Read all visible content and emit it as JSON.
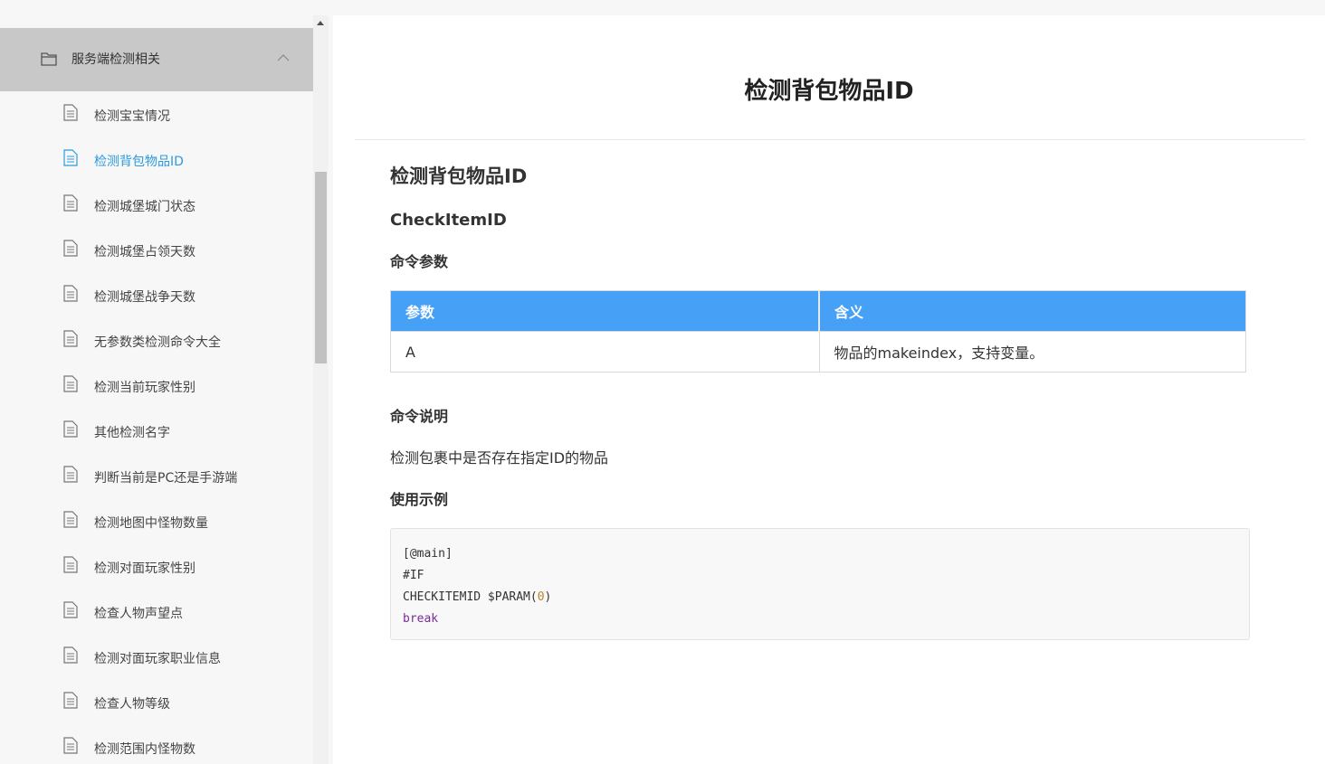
{
  "sidebar": {
    "group": {
      "title": "服务端检测相关",
      "icon": "folder-icon",
      "expanded_icon": "chevron-up-icon"
    },
    "items": [
      {
        "label": "检测宝宝情况",
        "icon": "document-icon",
        "active": false
      },
      {
        "label": "检测背包物品ID",
        "icon": "document-icon",
        "active": true
      },
      {
        "label": "检测城堡城门状态",
        "icon": "document-icon",
        "active": false
      },
      {
        "label": "检测城堡占领天数",
        "icon": "document-icon",
        "active": false
      },
      {
        "label": "检测城堡战争天数",
        "icon": "document-icon",
        "active": false
      },
      {
        "label": "无参数类检测命令大全",
        "icon": "document-icon",
        "active": false
      },
      {
        "label": "检测当前玩家性别",
        "icon": "document-icon",
        "active": false
      },
      {
        "label": "其他检测名字",
        "icon": "document-icon",
        "active": false
      },
      {
        "label": "判断当前是PC还是手游端",
        "icon": "document-icon",
        "active": false
      },
      {
        "label": "检测地图中怪物数量",
        "icon": "document-icon",
        "active": false
      },
      {
        "label": "检测对面玩家性别",
        "icon": "document-icon",
        "active": false
      },
      {
        "label": "检查人物声望点",
        "icon": "document-icon",
        "active": false
      },
      {
        "label": "检测对面玩家职业信息",
        "icon": "document-icon",
        "active": false
      },
      {
        "label": "检查人物等级",
        "icon": "document-icon",
        "active": false
      },
      {
        "label": "检测范围内怪物数",
        "icon": "document-icon",
        "active": false
      }
    ]
  },
  "main": {
    "page_title": "检测背包物品ID",
    "heading": "检测背包物品ID",
    "command_name": "CheckItemID",
    "params_heading": "命令参数",
    "params_table": {
      "headers": [
        "参数",
        "含义"
      ],
      "rows": [
        [
          "A",
          "物品的makeindex，支持变量。"
        ]
      ]
    },
    "desc_heading": "命令说明",
    "description": "检测包裹中是否存在指定ID的物品",
    "example_heading": "使用示例",
    "code": {
      "line1": "[@main]",
      "line2": "#IF",
      "line3_prefix": "CHECKITEMID $PARAM(",
      "line3_num": "0",
      "line3_suffix": ")",
      "line4": "break"
    }
  },
  "colors": {
    "accent": "#2a9be0",
    "table_header": "#46a0f5",
    "group_header_bg": "#c8c8c8"
  }
}
